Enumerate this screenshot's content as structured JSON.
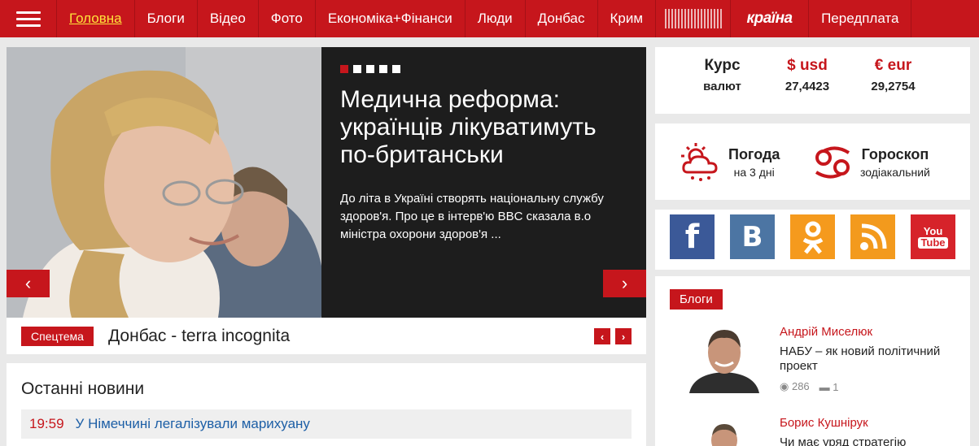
{
  "nav": {
    "items": [
      "Головна",
      "Блоги",
      "Відео",
      "Фото",
      "Економіка+Фінанси",
      "Люди",
      "Донбас",
      "Крим"
    ],
    "logo_brand": "країна",
    "subscribe": "Передплата"
  },
  "slider": {
    "title": "Медична реформа: українців лікуватимуть по-британськи",
    "description": "До літа в Україні створять національну службу здоров'я. Про це в інтерв'ю BBC сказала в.о міністра охорони здоров'я ...",
    "dots_total": 5,
    "active_dot": 1,
    "prev_icon": "chevron-left-icon",
    "next_icon": "chevron-right-icon"
  },
  "special": {
    "badge": "Спецтема",
    "title": "Донбас - terra incognita"
  },
  "news": {
    "heading": "Останні новини",
    "items": [
      {
        "time": "19:59",
        "title": "У Німеччині легалізували марихуану"
      }
    ]
  },
  "currency": {
    "label_top": "Курс",
    "label_bottom": "валют",
    "usd_symbol": "$",
    "usd_name": "usd",
    "usd_value": "27,4423",
    "eur_symbol": "€",
    "eur_name": "eur",
    "eur_value": "29,2754"
  },
  "widgets": {
    "weather_title": "Погода",
    "weather_sub": "на 3 дні",
    "horoscope_title": "Гороскоп",
    "horoscope_sub": "зодіакальний"
  },
  "social": [
    {
      "name": "facebook",
      "glyph": "f",
      "color": "#3b5998"
    },
    {
      "name": "vkontakte",
      "glyph": "B",
      "color": "#4c75a3"
    },
    {
      "name": "odnoklassniki",
      "glyph": "ok",
      "color": "#f59a1d"
    },
    {
      "name": "rss",
      "glyph": "rss",
      "color": "#f39a1d"
    },
    {
      "name": "youtube",
      "glyph": "YouTube",
      "color": "#d6232a"
    }
  ],
  "blogs": {
    "badge": "Блоги",
    "items": [
      {
        "author": "Андрій Миселюк",
        "title": "НАБУ – як новий політичний проект",
        "views": "286",
        "comments": "1"
      },
      {
        "author": "Борис Кушнірук",
        "title": "Чи має уряд стратегію",
        "views": "",
        "comments": ""
      }
    ]
  },
  "colors": {
    "brand": "#c6161c",
    "link": "#1d5fa6"
  }
}
